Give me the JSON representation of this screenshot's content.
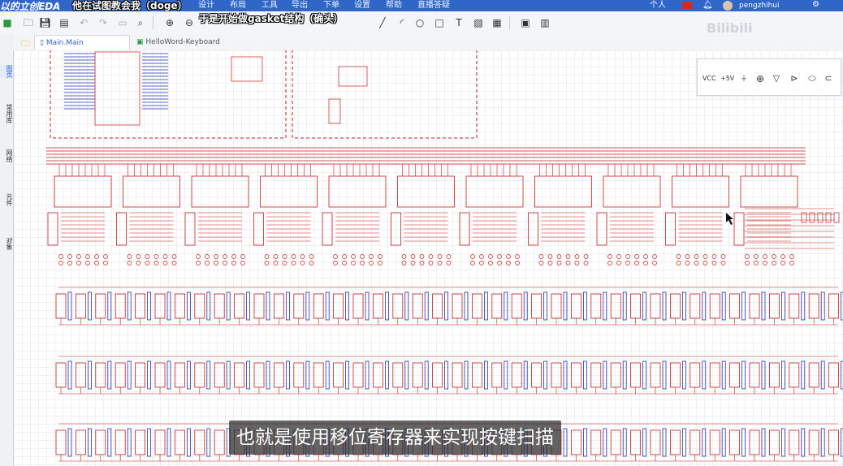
{
  "topbar": {
    "brand": "以的立创EDA",
    "title_overlay": "他在试图教会我（doge）",
    "menus": [
      "设计",
      "布局",
      "工具",
      "导出",
      "下单",
      "设置",
      "帮助",
      "直播答疑"
    ],
    "lang": "个人",
    "username": "pengzhihui"
  },
  "overlay_caption": "于是开始做gasket结构（确头）",
  "sidebar": {
    "items": [
      "图页",
      "常用库",
      "网络",
      "元件",
      "对象"
    ]
  },
  "tabs": [
    {
      "label": "Main.Main",
      "icon": "schematic-icon"
    },
    {
      "label": "HelloWord-Keyboard",
      "icon": "pcb-icon"
    }
  ],
  "floating_toolbar": {
    "items": [
      "VCC",
      "+5V",
      "GND-icon",
      "arrow-down",
      "bus",
      "port",
      "tag",
      "wire"
    ]
  },
  "watermark": "Bilibili",
  "subtitle": "也就是使用移位寄存器来实现按键扫描",
  "colors": {
    "topbar": "#2f66c8",
    "wire": "#c81e1e",
    "net": "#2233aa"
  }
}
